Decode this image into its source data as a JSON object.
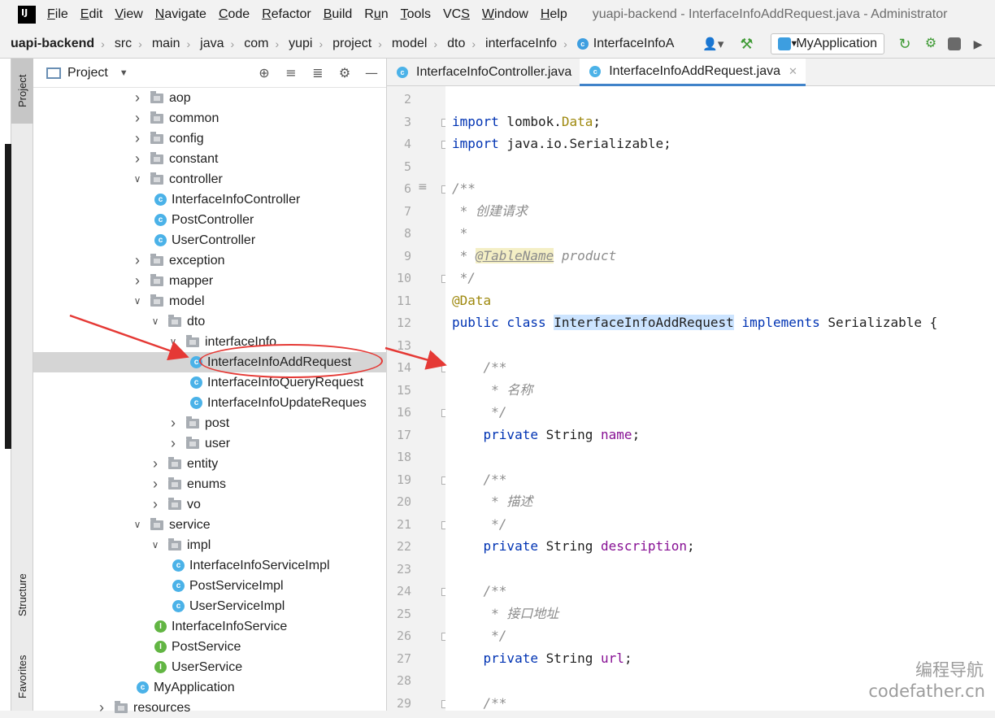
{
  "menubar": {
    "items": [
      {
        "label": "File",
        "mnemonic": "F",
        "rest": "ile"
      },
      {
        "label": "Edit",
        "mnemonic": "E",
        "rest": "dit"
      },
      {
        "label": "View",
        "mnemonic": "V",
        "rest": "iew"
      },
      {
        "label": "Navigate",
        "mnemonic": "N",
        "rest": "avigate"
      },
      {
        "label": "Code",
        "mnemonic": "C",
        "rest": "ode"
      },
      {
        "label": "Refactor",
        "mnemonic": "R",
        "rest": "efactor"
      },
      {
        "label": "Build",
        "mnemonic": "B",
        "rest": "uild"
      },
      {
        "label": "Run",
        "mnemonic": "u",
        "pre": "R",
        "rest": "n"
      },
      {
        "label": "Tools",
        "mnemonic": "T",
        "rest": "ools"
      },
      {
        "label": "VCS",
        "mnemonic": "S",
        "pre": "VC",
        "rest": ""
      },
      {
        "label": "Window",
        "mnemonic": "W",
        "rest": "indow"
      },
      {
        "label": "Help",
        "mnemonic": "H",
        "rest": "elp"
      }
    ],
    "window_title": "yuapi-backend - InterfaceInfoAddRequest.java - Administrator"
  },
  "breadcrumb": {
    "items": [
      "uapi-backend",
      "src",
      "main",
      "java",
      "com",
      "yupi",
      "project",
      "model",
      "dto",
      "interfaceInfo"
    ],
    "last": "InterfaceInfoA"
  },
  "run_config": {
    "label": "MyApplication"
  },
  "project_panel": {
    "title": "Project",
    "tree": [
      {
        "label": "aop",
        "kind": "folder",
        "depth": 0,
        "expanded": false
      },
      {
        "label": "common",
        "kind": "folder",
        "depth": 0,
        "expanded": false
      },
      {
        "label": "config",
        "kind": "folder",
        "depth": 0,
        "expanded": false
      },
      {
        "label": "constant",
        "kind": "folder",
        "depth": 0,
        "expanded": false
      },
      {
        "label": "controller",
        "kind": "folder",
        "depth": 0,
        "expanded": true
      },
      {
        "label": "InterfaceInfoController",
        "kind": "class",
        "depth": 1
      },
      {
        "label": "PostController",
        "kind": "class",
        "depth": 1
      },
      {
        "label": "UserController",
        "kind": "class",
        "depth": 1
      },
      {
        "label": "exception",
        "kind": "folder",
        "depth": 0,
        "expanded": false
      },
      {
        "label": "mapper",
        "kind": "folder",
        "depth": 0,
        "expanded": false
      },
      {
        "label": "model",
        "kind": "folder",
        "depth": 0,
        "expanded": true
      },
      {
        "label": "dto",
        "kind": "folder",
        "depth": 1,
        "expanded": true
      },
      {
        "label": "interfaceInfo",
        "kind": "folder",
        "depth": 2,
        "expanded": true
      },
      {
        "label": "InterfaceInfoAddRequest",
        "kind": "class",
        "depth": 3,
        "selected": true
      },
      {
        "label": "InterfaceInfoQueryRequest",
        "kind": "class",
        "depth": 3
      },
      {
        "label": "InterfaceInfoUpdateReques",
        "kind": "class",
        "depth": 3
      },
      {
        "label": "post",
        "kind": "folder",
        "depth": 2,
        "expanded": false
      },
      {
        "label": "user",
        "kind": "folder",
        "depth": 2,
        "expanded": false
      },
      {
        "label": "entity",
        "kind": "folder",
        "depth": 1,
        "expanded": false
      },
      {
        "label": "enums",
        "kind": "folder",
        "depth": 1,
        "expanded": false
      },
      {
        "label": "vo",
        "kind": "folder",
        "depth": 1,
        "expanded": false
      },
      {
        "label": "service",
        "kind": "folder",
        "depth": 0,
        "expanded": true
      },
      {
        "label": "impl",
        "kind": "folder",
        "depth": 1,
        "expanded": true
      },
      {
        "label": "InterfaceInfoServiceImpl",
        "kind": "class",
        "depth": 2
      },
      {
        "label": "PostServiceImpl",
        "kind": "class",
        "depth": 2
      },
      {
        "label": "UserServiceImpl",
        "kind": "class",
        "depth": 2
      },
      {
        "label": "InterfaceInfoService",
        "kind": "interface",
        "depth": 1
      },
      {
        "label": "PostService",
        "kind": "interface",
        "depth": 1
      },
      {
        "label": "UserService",
        "kind": "interface",
        "depth": 1
      },
      {
        "label": "MyApplication",
        "kind": "app",
        "depth": 0
      },
      {
        "label": "resources",
        "kind": "folder",
        "depth": -2,
        "expanded": false
      }
    ]
  },
  "side_tabs": {
    "project": "Project",
    "structure": "Structure",
    "favorites": "Favorites"
  },
  "editor": {
    "tabs": [
      {
        "label": "InterfaceInfoController.java",
        "active": false
      },
      {
        "label": "InterfaceInfoAddRequest.java",
        "active": true
      }
    ],
    "lines": [
      {
        "n": "2",
        "html": ""
      },
      {
        "n": "3",
        "html": "<span class='kw'>import</span> lombok.<span class='ann'>Data</span>;"
      },
      {
        "n": "4",
        "html": "<span class='kw'>import</span> java.io.Serializable;"
      },
      {
        "n": "5",
        "html": ""
      },
      {
        "n": "6",
        "html": "<span class='cm'>/**</span>"
      },
      {
        "n": "7",
        "html": "<span class='cm'> * 创建请求</span>"
      },
      {
        "n": "8",
        "html": "<span class='cm'> *</span>"
      },
      {
        "n": "9",
        "html": "<span class='cm'> * </span><span class='tag'>@TableName</span><span class='cm'> product</span>"
      },
      {
        "n": "10",
        "html": "<span class='cm'> */</span>"
      },
      {
        "n": "11",
        "html": "<span class='ann'>@Data</span>"
      },
      {
        "n": "12",
        "html": "<span class='kw'>public class</span> <span class='hl'>InterfaceInfoAddRequest</span> <span class='kw'>implements</span> Serializable {"
      },
      {
        "n": "13",
        "html": ""
      },
      {
        "n": "14",
        "html": "    <span class='cm'>/**</span>"
      },
      {
        "n": "15",
        "html": "<span class='cm'>     * 名称</span>"
      },
      {
        "n": "16",
        "html": "<span class='cm'>     */</span>"
      },
      {
        "n": "17",
        "html": "    <span class='kw'>private</span> String <span class='fld'>name</span>;"
      },
      {
        "n": "18",
        "html": ""
      },
      {
        "n": "19",
        "html": "    <span class='cm'>/**</span>"
      },
      {
        "n": "20",
        "html": "<span class='cm'>     * 描述</span>"
      },
      {
        "n": "21",
        "html": "<span class='cm'>     */</span>"
      },
      {
        "n": "22",
        "html": "    <span class='kw'>private</span> String <span class='fld'>description</span>;"
      },
      {
        "n": "23",
        "html": ""
      },
      {
        "n": "24",
        "html": "    <span class='cm'>/**</span>"
      },
      {
        "n": "25",
        "html": "<span class='cm'>     * 接口地址</span>"
      },
      {
        "n": "26",
        "html": "<span class='cm'>     */</span>"
      },
      {
        "n": "27",
        "html": "    <span class='kw'>private</span> String <span class='fld'>url</span>;"
      },
      {
        "n": "28",
        "html": ""
      },
      {
        "n": "29",
        "html": "    <span class='cm'>/**</span>"
      }
    ]
  },
  "watermark": {
    "line1": "编程导航",
    "line2": "codefather.cn"
  },
  "colors": {
    "accent": "#4083c9",
    "annotation_red": "#e53935"
  }
}
